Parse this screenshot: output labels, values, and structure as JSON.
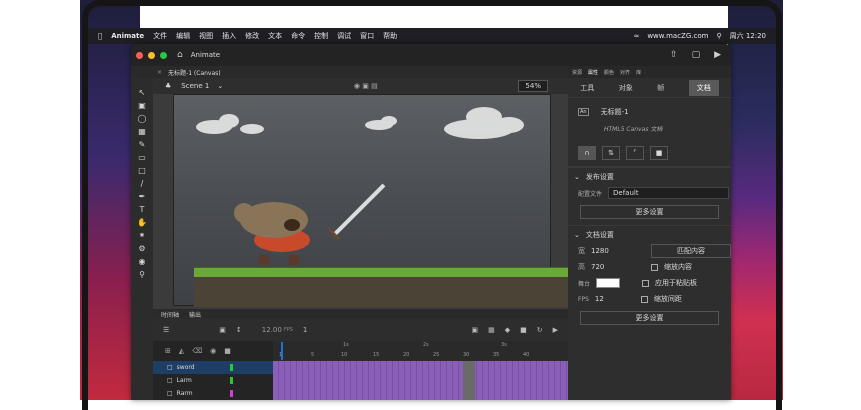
{
  "menubar": {
    "apple": "",
    "items": [
      "Animate",
      "文件",
      "编辑",
      "视图",
      "插入",
      "修改",
      "文本",
      "命令",
      "控制",
      "调试",
      "窗口",
      "帮助"
    ],
    "right": [
      "www.macZG.com",
      "周六 12:20"
    ]
  },
  "window": {
    "title": "Animate",
    "doc_tab": "无标题-1 (Canvas)",
    "scene": "Scene 1",
    "zoom": "54%"
  },
  "timeline": {
    "tabs": [
      "时间轴",
      "输出"
    ],
    "fps": "12.00",
    "fps_unit": "FPS",
    "frame": "1",
    "ticks": [
      "1s",
      "2s",
      "3s"
    ],
    "frame_numbers": [
      "1",
      "5",
      "10",
      "15",
      "20",
      "25",
      "30",
      "35",
      "40"
    ],
    "layers": [
      "sword",
      "Larm",
      "Rarm"
    ]
  },
  "props": {
    "top_tabs": [
      "资源",
      "属性",
      "颜色",
      "对齐",
      "库"
    ],
    "tabs": [
      "工具",
      "对象",
      "帧",
      "文档"
    ],
    "doc_name": "无标题-1",
    "doc_type": "HTML5 Canvas 文档",
    "publish_section": "发布设置",
    "profile_label": "配置文件",
    "profile_value": "Default",
    "more_settings": "更多设置",
    "doc_section": "文档设置",
    "width_label": "宽",
    "width_value": "1280",
    "match_content": "匹配内容",
    "height_label": "高",
    "height_value": "720",
    "scale_content": "缩放内容",
    "stage_label": "舞台",
    "apply_pasteboard": "应用于粘贴板",
    "fps_label": "FPS",
    "fps_value": "12",
    "scale_spacing": "缩放间距",
    "more_settings_2": "更多设置"
  },
  "colors": {
    "accent": "#1473e6",
    "selected_layer": "#1e3e66"
  }
}
